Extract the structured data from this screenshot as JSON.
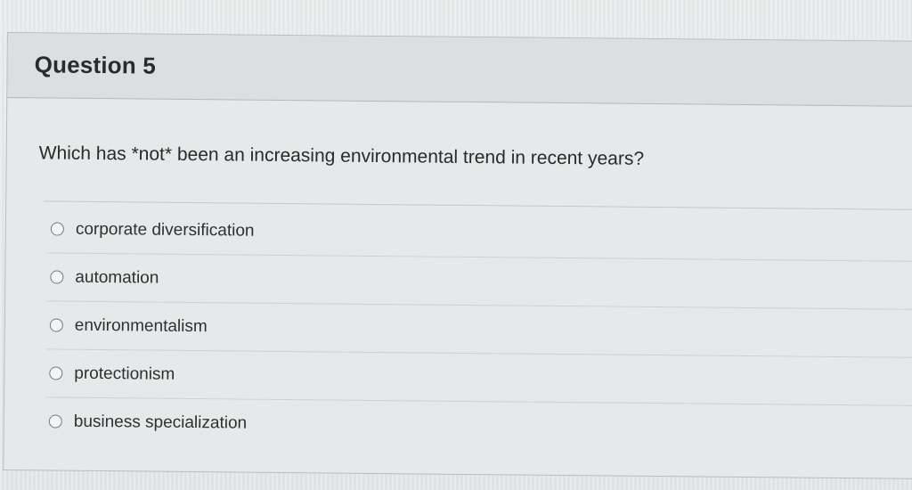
{
  "question": {
    "title": "Question 5",
    "prompt": "Which has *not* been an increasing environmental trend in recent years?",
    "options": [
      {
        "label": "corporate diversification"
      },
      {
        "label": "automation"
      },
      {
        "label": "environmentalism"
      },
      {
        "label": "protectionism"
      },
      {
        "label": "business specialization"
      }
    ]
  }
}
